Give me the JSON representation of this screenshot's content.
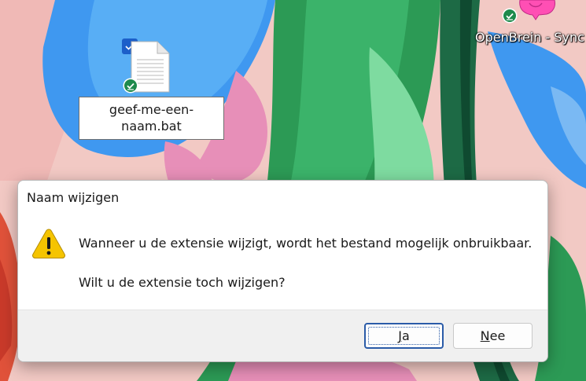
{
  "desktop": {
    "file": {
      "name_line1": "geef-me-een-",
      "name_line2": "naam.bat",
      "icon": "document-icon"
    },
    "app": {
      "label": "OpenBrein - Sync",
      "icon": "brain-icon"
    },
    "colors": {
      "sync_badge": "#1e8a4c",
      "selection_check": "#1c5fc9"
    }
  },
  "dialog": {
    "title": "Naam wijzigen",
    "icon": "warning-icon",
    "message_line1": "Wanneer u de extensie wijzigt, wordt het bestand mogelijk onbruikbaar.",
    "message_line2": "Wilt u de extensie toch wijzigen?",
    "buttons": {
      "yes": {
        "accel": "J",
        "rest": "a"
      },
      "no": {
        "accel": "N",
        "rest": "ee"
      }
    },
    "colors": {
      "warning_fill": "#f5c400",
      "default_button_border": "#2a5ba8",
      "footer_bg": "#f0f0f0"
    }
  }
}
